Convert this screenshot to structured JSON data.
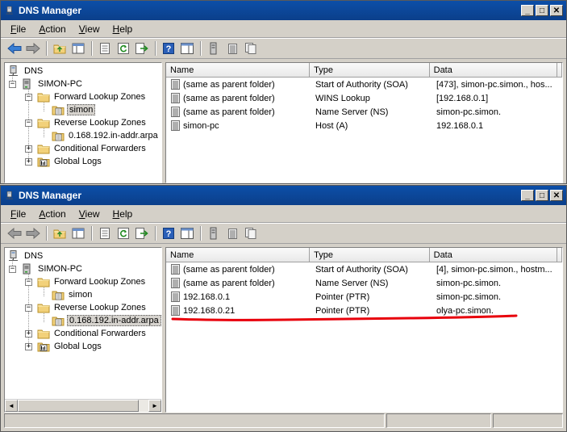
{
  "windows": [
    {
      "title": "DNS Manager",
      "menu": [
        {
          "accel": "F",
          "rest": "ile"
        },
        {
          "accel": "A",
          "rest": "ction"
        },
        {
          "accel": "V",
          "rest": "iew"
        },
        {
          "accel": "H",
          "rest": "elp"
        }
      ],
      "tree": {
        "root": "DNS",
        "server": "SIMON-PC",
        "forward_zones": "Forward Lookup Zones",
        "forward_zone_child": "simon",
        "reverse_zones": "Reverse Lookup Zones",
        "reverse_zone_child": "0.168.192.in-addr.arpa",
        "conditional_forwarders": "Conditional Forwarders",
        "global_logs": "Global Logs"
      },
      "columns": {
        "name": "Name",
        "type": "Type",
        "data": "Data"
      },
      "rows": [
        {
          "name": "(same as parent folder)",
          "type": "Start of Authority (SOA)",
          "data": "[473], simon-pc.simon., hos..."
        },
        {
          "name": "(same as parent folder)",
          "type": "WINS Lookup",
          "data": "[192.168.0.1]"
        },
        {
          "name": "(same as parent folder)",
          "type": "Name Server (NS)",
          "data": "simon-pc.simon."
        },
        {
          "name": "simon-pc",
          "type": "Host (A)",
          "data": "192.168.0.1"
        }
      ]
    },
    {
      "title": "DNS Manager",
      "menu": [
        {
          "accel": "F",
          "rest": "ile"
        },
        {
          "accel": "A",
          "rest": "ction"
        },
        {
          "accel": "V",
          "rest": "iew"
        },
        {
          "accel": "H",
          "rest": "elp"
        }
      ],
      "tree": {
        "root": "DNS",
        "server": "SIMON-PC",
        "forward_zones": "Forward Lookup Zones",
        "forward_zone_child": "simon",
        "reverse_zones": "Reverse Lookup Zones",
        "reverse_zone_child": "0.168.192.in-addr.arpa",
        "conditional_forwarders": "Conditional Forwarders",
        "global_logs": "Global Logs"
      },
      "columns": {
        "name": "Name",
        "type": "Type",
        "data": "Data"
      },
      "rows": [
        {
          "name": "(same as parent folder)",
          "type": "Start of Authority (SOA)",
          "data": "[4], simon-pc.simon., hostm..."
        },
        {
          "name": "(same as parent folder)",
          "type": "Name Server (NS)",
          "data": "simon-pc.simon."
        },
        {
          "name": "192.168.0.1",
          "type": "Pointer (PTR)",
          "data": "simon-pc.simon."
        },
        {
          "name": "192.168.0.21",
          "type": "Pointer (PTR)",
          "data": "olya-pc.simon."
        }
      ]
    }
  ],
  "window_buttons": {
    "minimize": "_",
    "maximize": "□",
    "close": "✕"
  },
  "icons": {
    "back": "back-arrow-icon",
    "forward": "forward-arrow-icon",
    "up": "up-folder-icon",
    "console-tree": "show-hide-tree-icon",
    "properties": "properties-icon",
    "refresh": "refresh-icon",
    "export": "export-list-icon",
    "help": "help-icon",
    "action-pane": "action-pane-icon",
    "record": "dns-record-icon",
    "folder": "folder-icon",
    "zone": "zone-icon",
    "server": "server-icon",
    "logs": "logs-icon"
  },
  "colors": {
    "titlebar": "#0c4fa8",
    "highlight": "#e8000b",
    "folder": "#f2d17a"
  }
}
